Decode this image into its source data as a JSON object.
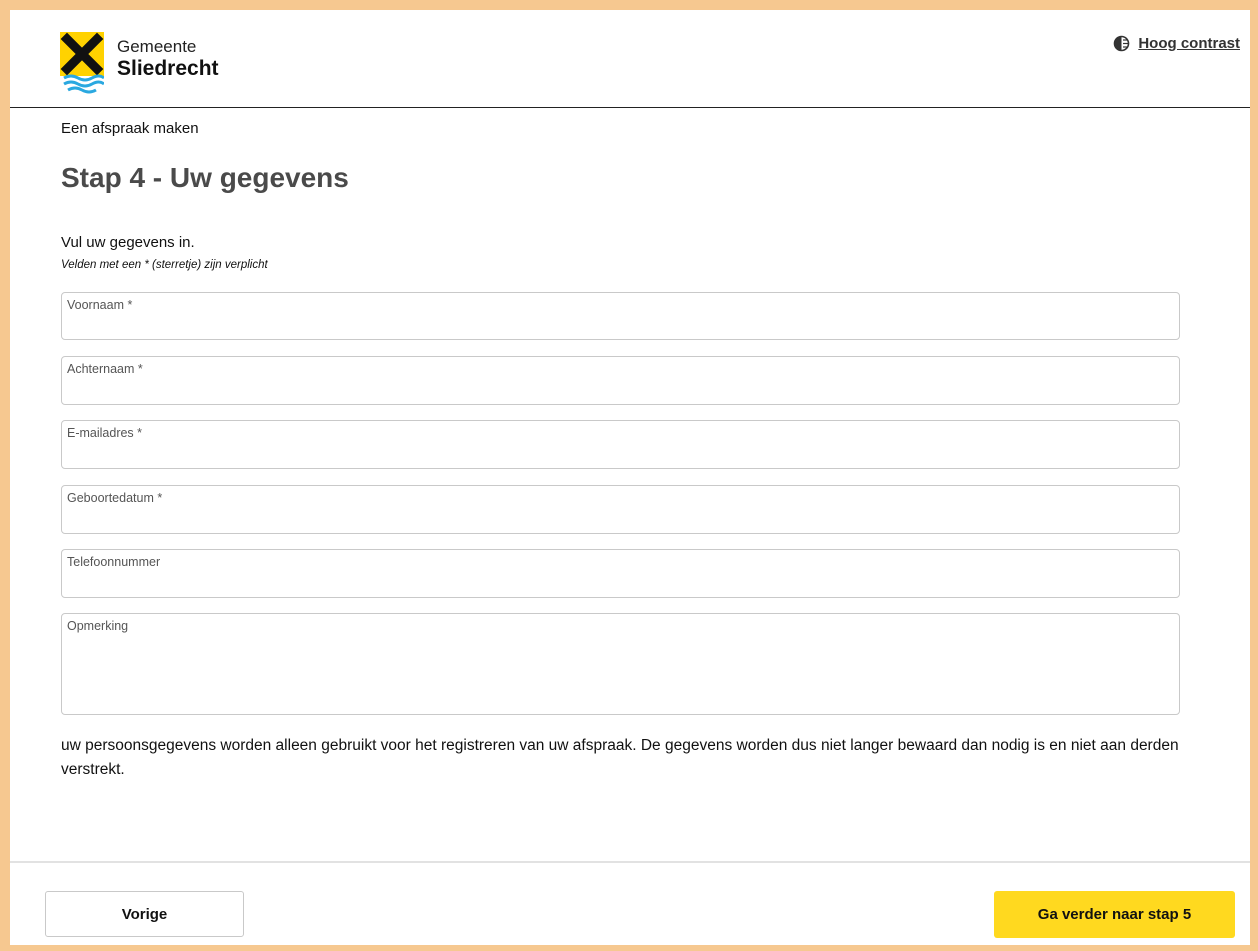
{
  "header": {
    "brand_top": "Gemeente",
    "brand_bottom": "Sliedrecht",
    "contrast_icon": "contrast-icon",
    "contrast_label": "Hoog contrast"
  },
  "breadcrumb": "Een afspraak maken",
  "title": "Stap 4 - Uw gegevens",
  "intro": "Vul uw gegevens in.",
  "required_note": "Velden met een * (sterretje) zijn verplicht",
  "fields": {
    "firstname": {
      "label": "Voornaam *",
      "value": ""
    },
    "lastname": {
      "label": "Achternaam *",
      "value": ""
    },
    "email": {
      "label": "E-mailadres *",
      "value": ""
    },
    "birthdate": {
      "label": "Geboortedatum *",
      "value": ""
    },
    "phone": {
      "label": "Telefoonnummer",
      "value": ""
    },
    "remark": {
      "label": "Opmerking",
      "value": ""
    }
  },
  "privacy_text": "uw persoonsgegevens worden alleen gebruikt voor het registreren van uw afspraak. De gegevens worden dus niet langer bewaard dan nodig is en niet aan derden verstrekt.",
  "footer": {
    "prev_label": "Vorige",
    "next_label": "Ga verder naar stap 5"
  },
  "colors": {
    "page_border": "#f6c890",
    "accent_button": "#ffd91f",
    "logo_yellow": "#ffd200",
    "logo_blue": "#2aa8e0"
  }
}
